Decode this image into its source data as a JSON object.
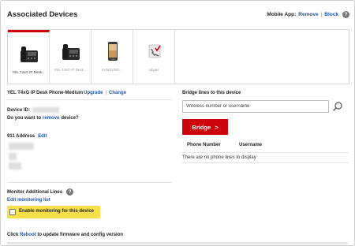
{
  "header": {
    "title": "Associated Devices",
    "mobile_app_label": "Mobile App:",
    "remove_label": "Remove",
    "separator": "|",
    "block_label": "Block",
    "help_glyph": "?"
  },
  "devices": [
    {
      "caption": "YEL T4xG IP Desk...",
      "icon": "desk-phone-icon",
      "selected": true
    },
    {
      "caption": "YEL T4xG IP Desk...",
      "icon": "desk-phone-icon",
      "selected": false
    },
    {
      "caption": "SAMSUNG...",
      "icon": "smartphone-icon",
      "selected": false
    },
    {
      "caption": "sdyjas",
      "icon": "softphone-icon",
      "selected": false
    }
  ],
  "device_info": {
    "model_text": "YEL T4xG IP Desk Phone-Medium",
    "upgrade_label": "Upgrade",
    "separator": "|",
    "change_label": "Change",
    "device_id_label": "Device ID:",
    "remove_question_prefix": "Do you want to",
    "remove_link": "remove",
    "remove_question_suffix": "device?",
    "address_label": "911 Address",
    "edit_label": "Edit"
  },
  "monitor": {
    "title": "Monitor Additional Lines",
    "edit_list_label": "Edit monitoring list",
    "checkbox_label": "Enable monitoring for this device",
    "checked": false
  },
  "bridge": {
    "title": "Bridge lines to this device",
    "input_placeholder": "Wireless number or username",
    "button_label": "Bridge",
    "button_arrow": ">",
    "col_phone": "Phone Number",
    "col_username": "Username",
    "empty_text": "There are no phone lines to display"
  },
  "footer": {
    "click_label": "Click",
    "reboot_link": "Reboot",
    "suffix": "to update firmware and config version"
  },
  "colors": {
    "accent": "#cd040b",
    "link": "#1a55b7",
    "highlight": "#f7e04a"
  }
}
